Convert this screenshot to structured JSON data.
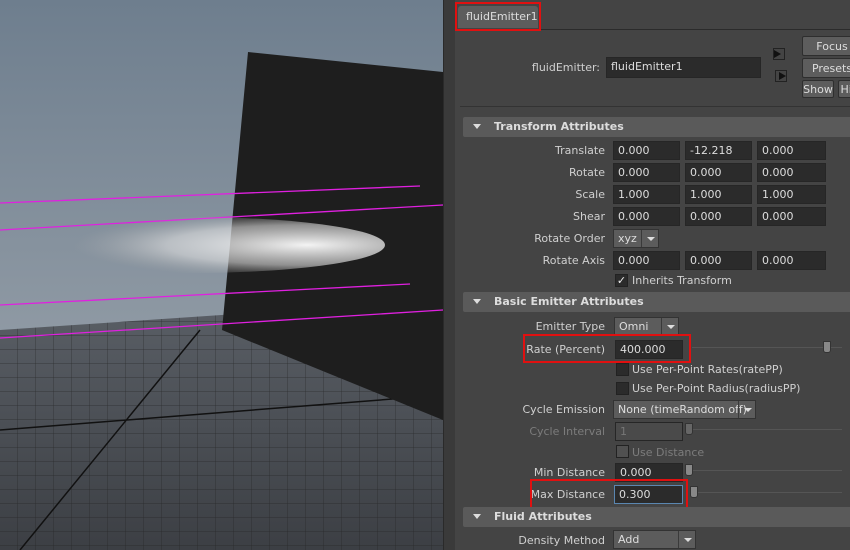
{
  "tab": {
    "label": "fluidEmitter1"
  },
  "node": {
    "label": "fluidEmitter:",
    "value": "fluidEmitter1"
  },
  "buttons": {
    "focus": "Focus",
    "presets": "Presets",
    "show": "Show",
    "hide": "Hide"
  },
  "transform": {
    "title": "Transform Attributes",
    "translate": {
      "label": "Translate",
      "values": [
        "0.000",
        "-12.218",
        "0.000"
      ]
    },
    "rotate": {
      "label": "Rotate",
      "values": [
        "0.000",
        "0.000",
        "0.000"
      ]
    },
    "scale": {
      "label": "Scale",
      "values": [
        "1.000",
        "1.000",
        "1.000"
      ]
    },
    "shear": {
      "label": "Shear",
      "values": [
        "0.000",
        "0.000",
        "0.000"
      ]
    },
    "rotate_order": {
      "label": "Rotate Order",
      "value": "xyz"
    },
    "rotate_axis": {
      "label": "Rotate Axis",
      "values": [
        "0.000",
        "0.000",
        "0.000"
      ]
    },
    "inherits": {
      "label": "Inherits Transform",
      "checked": true
    }
  },
  "basic": {
    "title": "Basic Emitter Attributes",
    "emitter_type": {
      "label": "Emitter Type",
      "value": "Omni"
    },
    "rate": {
      "label": "Rate (Percent)",
      "value": "400.000",
      "slider": 0.9
    },
    "per_point_rates": {
      "label": "Use Per-Point Rates(ratePP)",
      "checked": false
    },
    "per_point_radius": {
      "label": "Use Per-Point Radius(radiusPP)",
      "checked": false
    },
    "cycle_emission": {
      "label": "Cycle Emission",
      "value": "None (timeRandom off)"
    },
    "cycle_interval": {
      "label": "Cycle Interval",
      "value": "1",
      "disabled": true
    },
    "use_distance": {
      "label": "Use Distance",
      "checked": false,
      "disabled": true
    },
    "min_distance": {
      "label": "Min Distance",
      "value": "0.000"
    },
    "max_distance": {
      "label": "Max Distance",
      "value": "0.300"
    }
  },
  "fluid": {
    "title": "Fluid Attributes",
    "density_method": {
      "label": "Density Method",
      "value": "Add"
    }
  },
  "colors": {
    "highlight": "#e01010",
    "panel": "#444444",
    "field": "#2b2b2b",
    "guide": "#e020e0"
  }
}
